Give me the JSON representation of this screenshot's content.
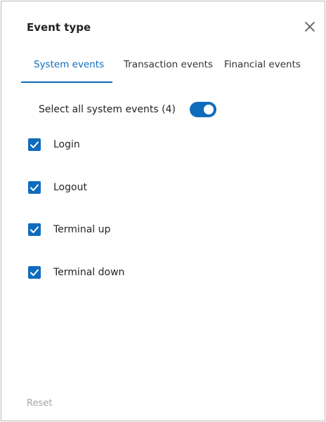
{
  "dialog": {
    "title": "Event type"
  },
  "tabs": [
    {
      "label": "System events",
      "active": true
    },
    {
      "label": "Transaction events",
      "active": false
    },
    {
      "label": "Financial events",
      "active": false
    }
  ],
  "select_all": {
    "label": "Select all system events (4)",
    "enabled": true
  },
  "events": [
    {
      "label": "Login",
      "checked": true
    },
    {
      "label": "Logout",
      "checked": true
    },
    {
      "label": "Terminal up",
      "checked": true
    },
    {
      "label": "Terminal down",
      "checked": true
    }
  ],
  "footer": {
    "reset_label": "Reset"
  },
  "colors": {
    "accent": "#0f6cbd",
    "text": "#242424",
    "disabled": "#a6a6a6"
  },
  "icons": {
    "close": "close-icon",
    "check": "checkmark-icon"
  }
}
